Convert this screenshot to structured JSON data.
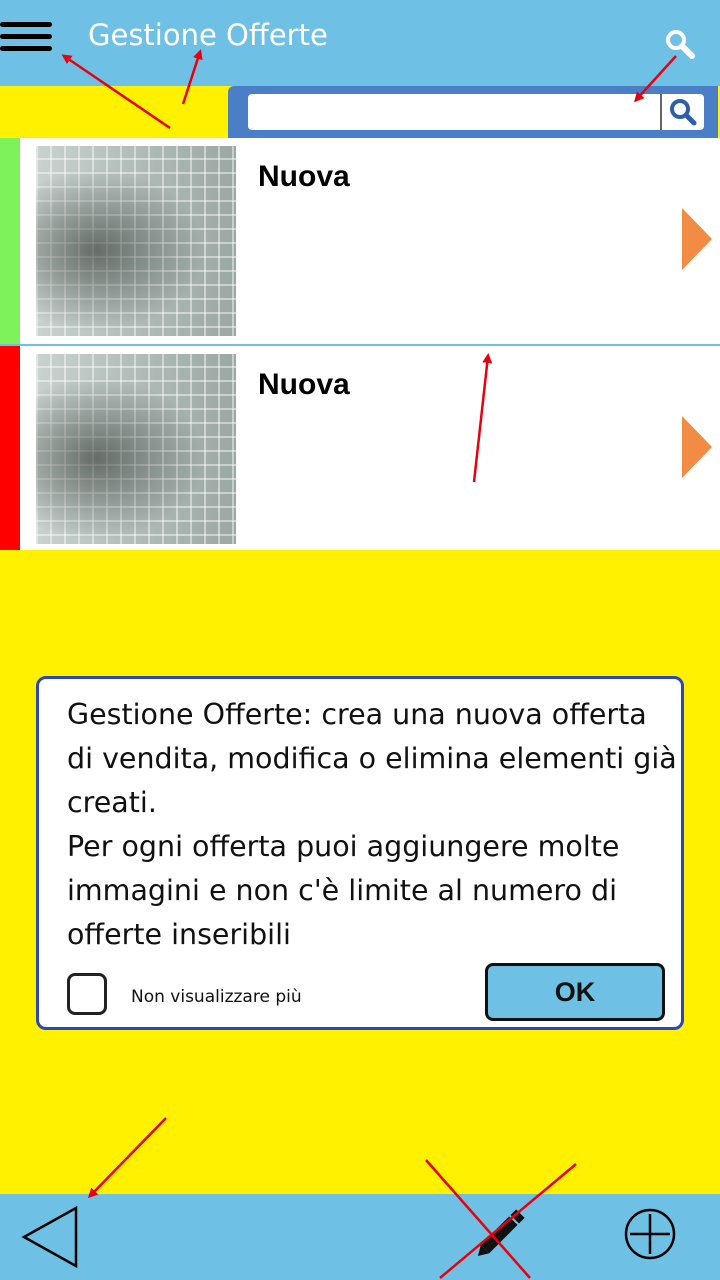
{
  "header": {
    "title": "Gestione Offerte",
    "menu_icon": "menu-icon",
    "search_icon": "search-icon"
  },
  "search": {
    "value": "",
    "placeholder": ""
  },
  "offers": [
    {
      "title": "Nuova",
      "status_color": "#7EF25A"
    },
    {
      "title": "Nuova",
      "status_color": "#FF0000"
    }
  ],
  "dialog": {
    "message_line1": "Gestione Offerte: crea una nuova offerta di vendita, modifica o elimina elementi già creati.",
    "message_line2": "Per ogni offerta puoi aggiungere molte immagini e non c'è limite al numero di offerte inseribili",
    "checkbox_label": "Non visualizzare più",
    "ok_label": "OK"
  },
  "footer": {
    "back_icon": "back-triangle-icon",
    "edit_icon": "pencil-icon",
    "add_icon": "plus-circle-icon"
  },
  "colors": {
    "bar": "#6EC1E4",
    "background": "#FFF100",
    "dialog_border": "#2E46B8",
    "chevron": "#F28C44",
    "annotation": "#E8000F"
  }
}
